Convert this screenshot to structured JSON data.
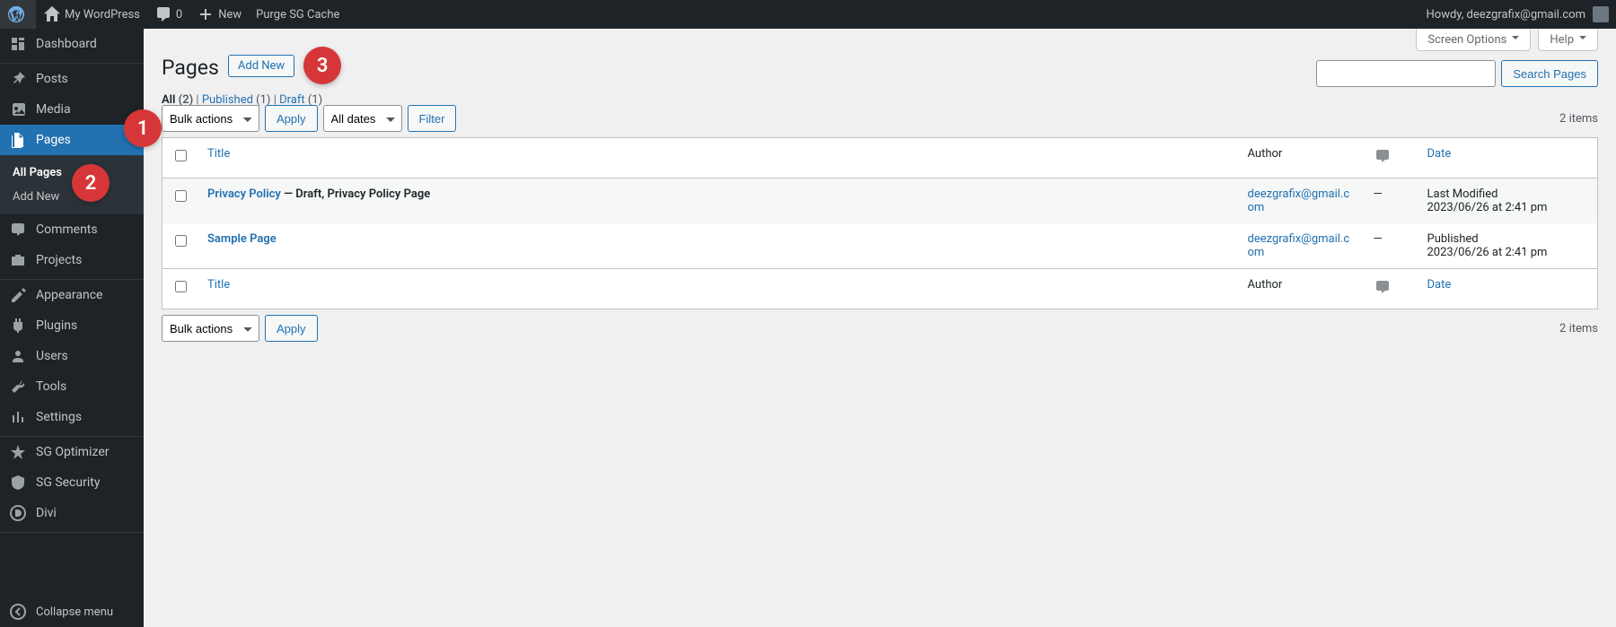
{
  "annotations": {
    "badge1": "1",
    "badge2": "2",
    "badge3": "3"
  },
  "adminbar": {
    "site": "My WordPress",
    "comments": "0",
    "new": "New",
    "purge": "Purge SG Cache",
    "howdy": "Howdy, deezgrafix@gmail.com"
  },
  "sidebar": {
    "dashboard": "Dashboard",
    "posts": "Posts",
    "media": "Media",
    "pages": "Pages",
    "pages_sub": {
      "all": "All Pages",
      "add": "Add New"
    },
    "comments": "Comments",
    "projects": "Projects",
    "appearance": "Appearance",
    "plugins": "Plugins",
    "users": "Users",
    "tools": "Tools",
    "settings": "Settings",
    "sg_optimizer": "SG Optimizer",
    "sg_security": "SG Security",
    "divi": "Divi",
    "collapse": "Collapse menu"
  },
  "screen_meta": {
    "screen_options": "Screen Options",
    "help": "Help"
  },
  "heading": {
    "title": "Pages",
    "add_new": "Add New"
  },
  "filters": {
    "all_label": "All",
    "all_count": "(2)",
    "published_label": "Published",
    "published_count": "(1)",
    "draft_label": "Draft",
    "draft_count": "(1)",
    "sep": " | "
  },
  "search": {
    "placeholder": "",
    "button": "Search Pages"
  },
  "tablenav": {
    "bulk": "Bulk actions",
    "apply": "Apply",
    "dates": "All dates",
    "filter": "Filter",
    "items": "2 items"
  },
  "columns": {
    "title": "Title",
    "author": "Author",
    "date": "Date"
  },
  "rows": [
    {
      "title": "Privacy Policy",
      "state": " — Draft, Privacy Policy Page",
      "author": "deezgrafix@gmail.com",
      "comments": "—",
      "date_l1": "Last Modified",
      "date_l2": "2023/06/26 at 2:41 pm"
    },
    {
      "title": "Sample Page",
      "state": "",
      "author": "deezgrafix@gmail.com",
      "comments": "—",
      "date_l1": "Published",
      "date_l2": "2023/06/26 at 2:41 pm"
    }
  ]
}
